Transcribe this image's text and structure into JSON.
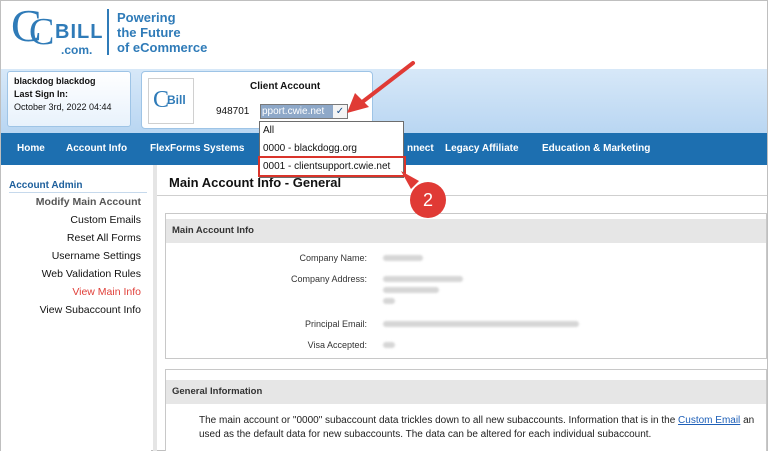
{
  "header": {
    "logo_text": "CCBill.com",
    "tagline_lines": [
      "Powering",
      "the Future",
      "of eCommerce"
    ]
  },
  "user": {
    "name": "blackdog  blackdog",
    "last_sign_in_label": "Last Sign In:",
    "last_sign_in_value": "October 3rd, 2022 04:44"
  },
  "client_account": {
    "title": "Client Account",
    "number": "948701",
    "selected": "pport.cwie.net"
  },
  "dropdown": {
    "options": [
      "All",
      "0000 - blackdogg.org",
      "0001 - clientsupport.cwie.net"
    ]
  },
  "nav": {
    "items": [
      "Home",
      "Account Info",
      "FlexForms Systems",
      "nnect",
      "Legacy Affiliate",
      "Education & Marketing"
    ]
  },
  "left_menu": {
    "title": "Account Admin",
    "items": [
      "Modify Main Account",
      "Custom Emails",
      "Reset All Forms",
      "Username Settings",
      "Web Validation Rules",
      "View Main Info",
      "View Subaccount Info"
    ]
  },
  "main": {
    "title": "Main Account Info - General",
    "panel1_title": "Main Account Info",
    "fields": [
      "Company Name:",
      "Company Address:",
      "Principal Email:",
      "Visa Accepted:"
    ],
    "panel2_title": "General Information",
    "info_line1_a": "The main account or \"0000\" subaccount data trickles down to all new subaccounts. Information that is in the ",
    "info_line1_link": "Custom Email",
    "info_line1_b": " an",
    "info_line2": "used as the default data for new subaccounts. The data can be altered for each individual subaccount."
  },
  "annotation": {
    "step_number": "2"
  },
  "colors": {
    "brand_blue": "#2f7bb8",
    "nav_blue": "#1d6fb0",
    "highlight_red": "#d9342b"
  }
}
